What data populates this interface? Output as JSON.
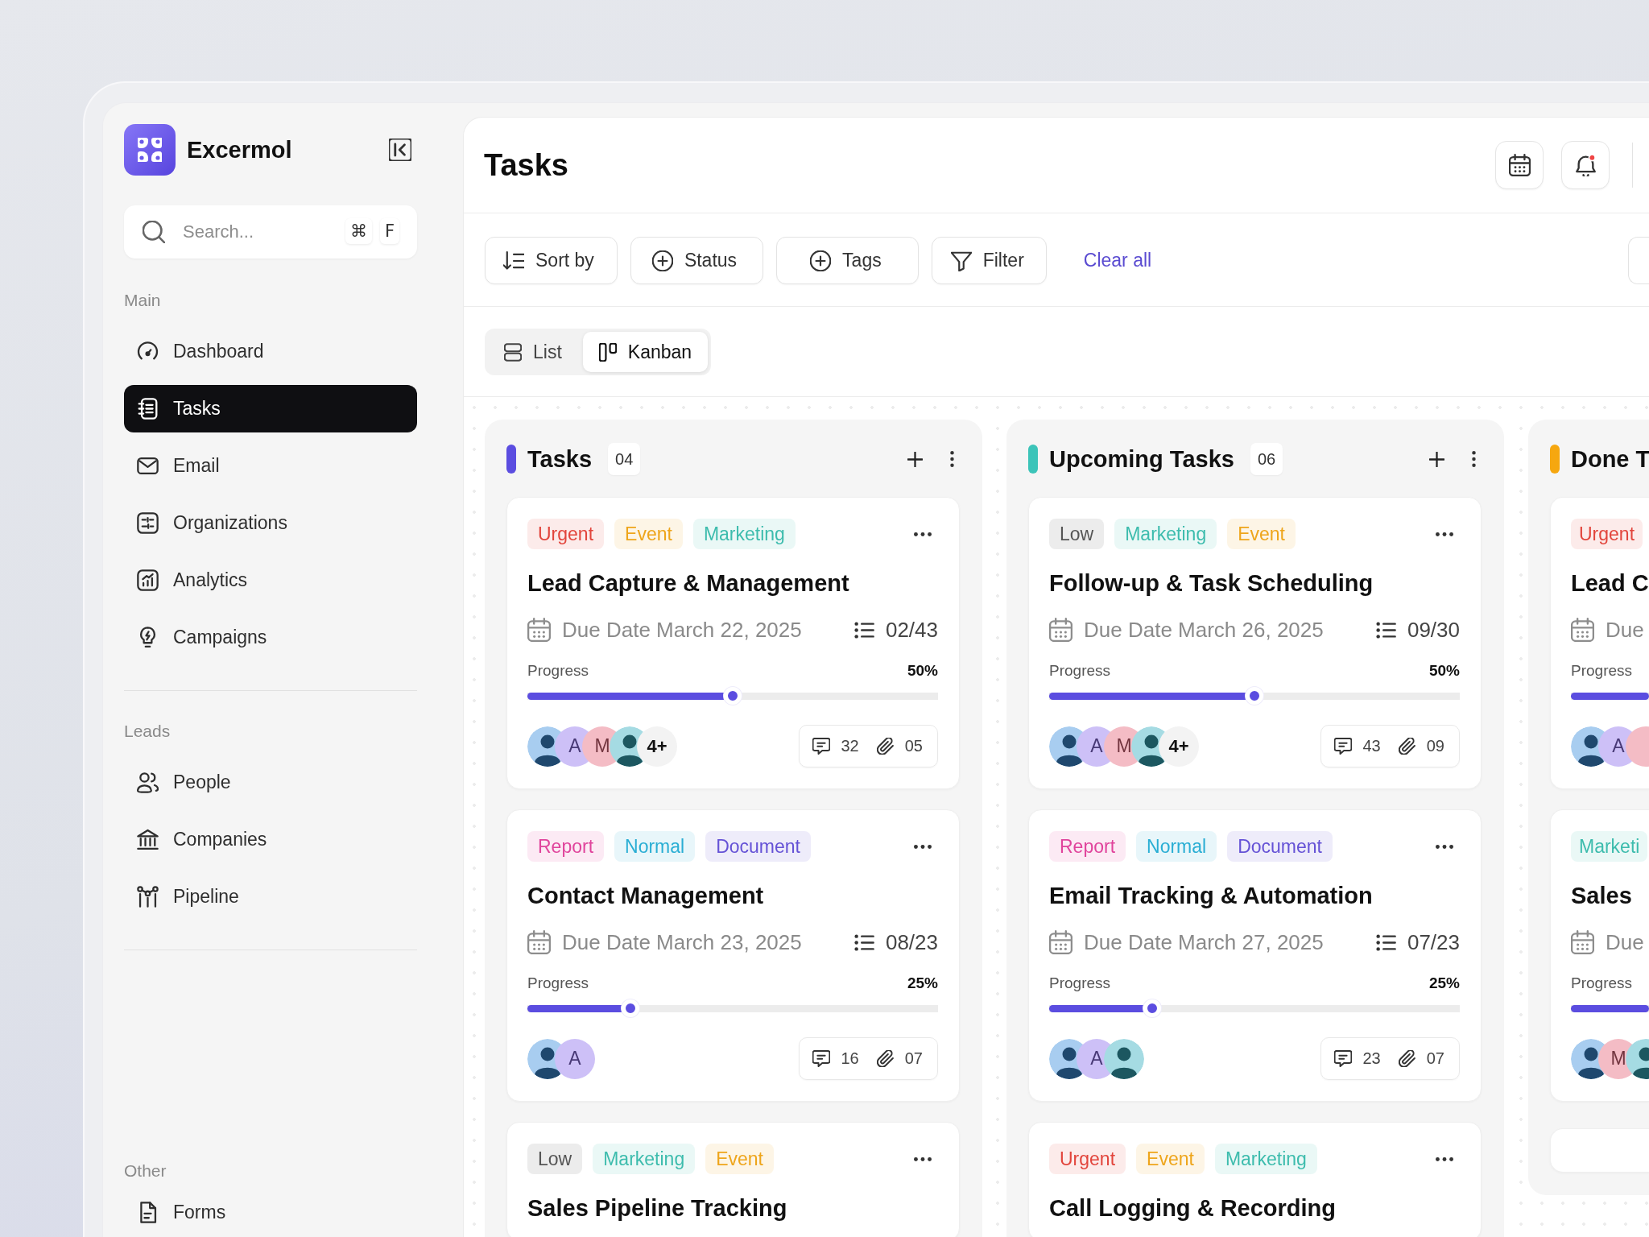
{
  "brand": {
    "name": "Excermol"
  },
  "search": {
    "placeholder": "Search...",
    "shortcut": [
      "⌘",
      "F"
    ]
  },
  "sidebar": {
    "sections": [
      {
        "heading": "Main",
        "items": [
          {
            "label": "Dashboard",
            "selected": false
          },
          {
            "label": "Tasks",
            "selected": true
          },
          {
            "label": "Email",
            "selected": false
          },
          {
            "label": "Organizations",
            "selected": false
          },
          {
            "label": "Analytics",
            "selected": false
          },
          {
            "label": "Campaigns",
            "selected": false
          }
        ]
      },
      {
        "heading": "Leads",
        "items": [
          {
            "label": "People",
            "selected": false
          },
          {
            "label": "Companies",
            "selected": false
          },
          {
            "label": "Pipeline",
            "selected": false
          }
        ]
      },
      {
        "heading": "Other",
        "items": [
          {
            "label": "Forms",
            "selected": false
          }
        ]
      }
    ]
  },
  "header": {
    "title": "Tasks"
  },
  "toolbar": {
    "buttons": [
      {
        "label": "Sort by"
      },
      {
        "label": "Status"
      },
      {
        "label": "Tags"
      },
      {
        "label": "Filter"
      }
    ],
    "clear": "Clear all"
  },
  "views": [
    {
      "label": "List",
      "selected": false
    },
    {
      "label": "Kanban",
      "selected": true
    }
  ],
  "columns": [
    {
      "kind": "full",
      "title": "Tasks",
      "count": "04",
      "color": "#5b4de0",
      "cards": [
        {
          "kind": "task",
          "tags": [
            {
              "label": "Urgent",
              "color": "#e2453c"
            },
            {
              "label": "Event",
              "color": "#eea51b"
            },
            {
              "label": "Marketing",
              "color": "#3dbcad"
            }
          ],
          "title": "Lead Capture & Management",
          "due": "Due Date March 22, 2025",
          "subtasks": "02/43",
          "progress_label": "Progress",
          "percent": "50%",
          "level": 0.5,
          "avatars": [
            {
              "kind": "figure",
              "color": "#a8cdf0"
            },
            {
              "kind": "initial",
              "letter": "A",
              "color": "#cdc0f7"
            },
            {
              "kind": "initial",
              "letter": "M",
              "color": "#f4bcc5"
            },
            {
              "kind": "figure",
              "color": "#a5dbe3"
            },
            {
              "kind": "more",
              "label": "4+"
            }
          ],
          "comments": "32",
          "attachments": "05"
        },
        {
          "kind": "task",
          "tags": [
            {
              "label": "Report",
              "color": "#e0449c"
            },
            {
              "label": "Normal",
              "color": "#2aaed4"
            },
            {
              "label": "Document",
              "color": "#6552d6"
            }
          ],
          "title": "Contact Management",
          "due": "Due Date March 23, 2025",
          "subtasks": "08/23",
          "progress_label": "Progress",
          "percent": "25%",
          "level": 0.25,
          "avatars": [
            {
              "kind": "figure",
              "color": "#a8cdf0"
            },
            {
              "kind": "initial",
              "letter": "A",
              "color": "#cdc0f7"
            }
          ],
          "comments": "16",
          "attachments": "07"
        },
        {
          "kind": "task",
          "tags": [
            {
              "label": "Low",
              "color": "#555555"
            },
            {
              "label": "Marketing",
              "color": "#3dbcad"
            },
            {
              "label": "Event",
              "color": "#eea51b"
            }
          ],
          "title": "Sales Pipeline Tracking"
        }
      ]
    },
    {
      "kind": "full",
      "title": "Upcoming Tasks",
      "count": "06",
      "color": "#3cc4b9",
      "cards": [
        {
          "kind": "task",
          "tags": [
            {
              "label": "Low",
              "color": "#555555"
            },
            {
              "label": "Marketing",
              "color": "#3dbcad"
            },
            {
              "label": "Event",
              "color": "#eea51b"
            }
          ],
          "title": "Follow-up & Task Scheduling",
          "due": "Due Date March 26, 2025",
          "subtasks": "09/30",
          "progress_label": "Progress",
          "percent": "50%",
          "level": 0.5,
          "avatars": [
            {
              "kind": "figure",
              "color": "#a8cdf0"
            },
            {
              "kind": "initial",
              "letter": "A",
              "color": "#cdc0f7"
            },
            {
              "kind": "initial",
              "letter": "M",
              "color": "#f4bcc5"
            },
            {
              "kind": "figure",
              "color": "#a5dbe3"
            },
            {
              "kind": "more",
              "label": "4+"
            }
          ],
          "comments": "43",
          "attachments": "09"
        },
        {
          "kind": "task",
          "tags": [
            {
              "label": "Report",
              "color": "#e0449c"
            },
            {
              "label": "Normal",
              "color": "#2aaed4"
            },
            {
              "label": "Document",
              "color": "#6552d6"
            }
          ],
          "title": "Email Tracking & Automation",
          "due": "Due Date March 27, 2025",
          "subtasks": "07/23",
          "progress_label": "Progress",
          "percent": "25%",
          "level": 0.25,
          "avatars": [
            {
              "kind": "figure",
              "color": "#a8cdf0"
            },
            {
              "kind": "initial",
              "letter": "A",
              "color": "#cdc0f7"
            },
            {
              "kind": "figure",
              "color": "#a5dbe3"
            }
          ],
          "comments": "23",
          "attachments": "07"
        },
        {
          "kind": "task",
          "tags": [
            {
              "label": "Urgent",
              "color": "#e2453c"
            },
            {
              "label": "Event",
              "color": "#eea51b"
            },
            {
              "label": "Marketing",
              "color": "#3dbcad"
            }
          ],
          "title": "Call Logging & Recording"
        }
      ]
    },
    {
      "kind": "partial",
      "title": "Done T",
      "color": "#f6a70f",
      "cards": [
        {
          "kind": "task",
          "tags": [
            {
              "label": "Urgent",
              "color": "#e2453c"
            }
          ],
          "title": "Lead C",
          "due": "Due",
          "progress_label": "Progress",
          "level": 1,
          "avatars": [
            {
              "kind": "figure",
              "color": "#a8cdf0"
            },
            {
              "kind": "initial",
              "letter": "A",
              "color": "#cdc0f7"
            },
            {
              "kind": "initial",
              "color": "#f4bcc5"
            }
          ]
        },
        {
          "kind": "task",
          "tags": [
            {
              "label": "Marketi",
              "color": "#3dbcad"
            }
          ],
          "title": "Sales",
          "due": "Due",
          "progress_label": "Progress",
          "level": 1,
          "avatars": [
            {
              "kind": "figure",
              "color": "#a8cdf0"
            },
            {
              "kind": "initial",
              "letter": "M",
              "color": "#f4bcc5"
            },
            {
              "kind": "figure",
              "color": "#a5dbe3"
            }
          ]
        },
        {
          "kind": "empty"
        }
      ]
    }
  ]
}
